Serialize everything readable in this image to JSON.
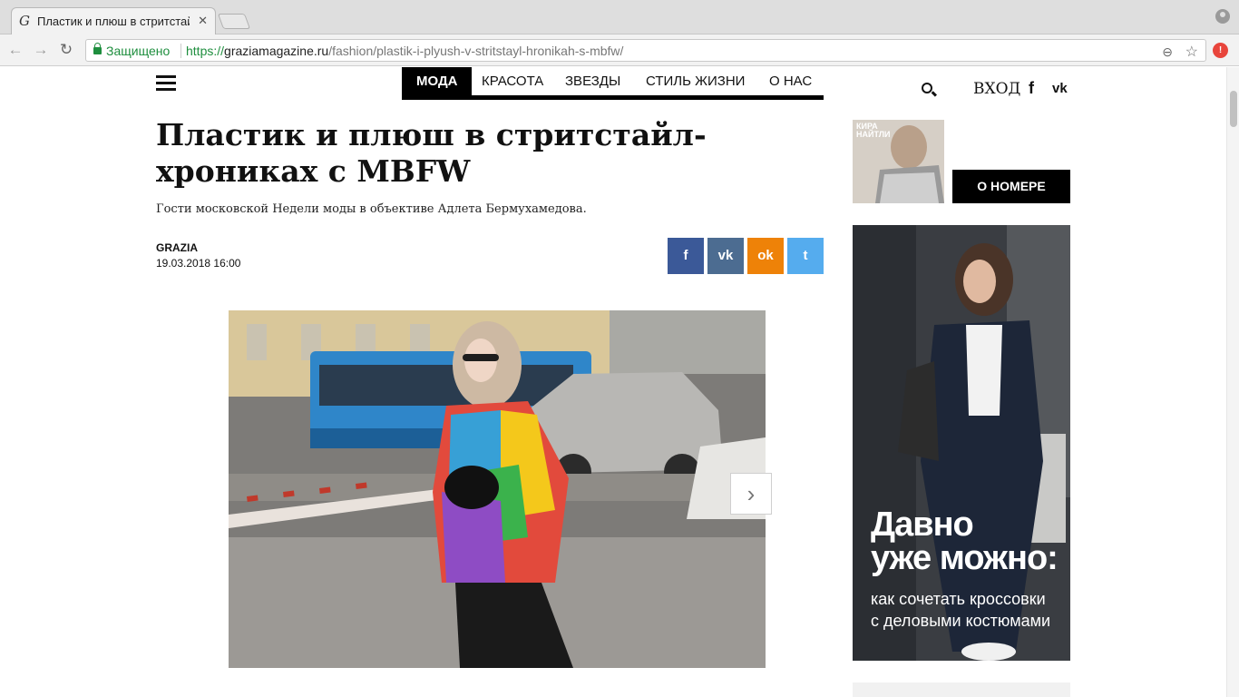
{
  "browser": {
    "tab_title": "Пластик и плюш в стритстайл-х",
    "tab_favicon": "G",
    "close_glyph": "✕",
    "secure_label": "Защищено",
    "url_proto": "https://",
    "url_host": "graziamagazine.ru",
    "url_path": "/fashion/plastik-i-plyush-v-stritstayl-hronikah-s-mbfw/",
    "back_glyph": "←",
    "forward_glyph": "→",
    "reload_glyph": "↻",
    "zoom_glyph": "⊖",
    "star_glyph": "☆",
    "menu_glyph": "!"
  },
  "nav": {
    "items": [
      {
        "label": "МОДА",
        "active": true
      },
      {
        "label": "КРАСОТА"
      },
      {
        "label": "ЗВЕЗДЫ"
      },
      {
        "label": "СТИЛЬ ЖИЗНИ"
      },
      {
        "label": "О НАС"
      }
    ],
    "login": "ВХОД",
    "fb": "f",
    "vk": "vk"
  },
  "article": {
    "title": "Пластик и плюш в стритстайл-хрониках с MBFW",
    "lead": "Гости московской Недели моды в объективе Адлета Бермухамедова.",
    "author": "GRAZIA",
    "date": "19.03.2018 16:00",
    "next_glyph": "›"
  },
  "share": {
    "facebook": {
      "label": "f",
      "color": "#3b5998"
    },
    "vk": {
      "label": "vk",
      "color": "#4c6c91"
    },
    "ok": {
      "label": "ok",
      "color": "#ee8208"
    },
    "twitter": {
      "label": "t",
      "color": "#55acee"
    }
  },
  "sidebar": {
    "issue_button": "О НОМЕРЕ",
    "cover_text": "КИРА НАЙТЛИ",
    "ad_headline_1": "Давно",
    "ad_headline_2": "уже можно:",
    "ad_sub_1": "как сочетать кроссовки",
    "ad_sub_2": "с деловыми костюмами"
  }
}
